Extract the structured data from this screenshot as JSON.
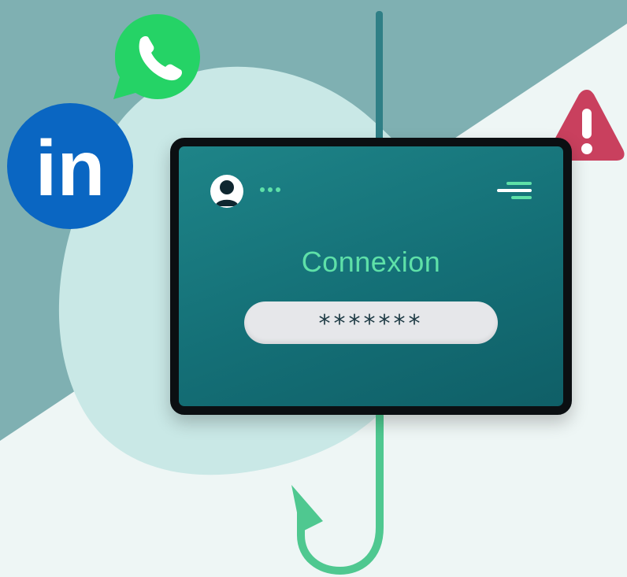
{
  "login": {
    "title": "Connexion",
    "password_masked": "*******"
  },
  "icons": {
    "linkedin": "linkedin-icon",
    "linkedin_text": "in",
    "whatsapp": "whatsapp-icon",
    "warning": "warning-icon",
    "fishing_hook": "fishing-hook-icon",
    "avatar": "user-avatar-icon",
    "more": "more-dots-icon",
    "menu": "menu-icon"
  },
  "colors": {
    "background_light": "#eef6f5",
    "background_dark": "#7daeb0",
    "blob": "#c9e8e6",
    "tablet_screen": "#17757b",
    "accent_green": "#5ee0a8",
    "linkedin_blue": "#0a66c2",
    "whatsapp_green": "#25d366",
    "warning_red": "#c9405e"
  }
}
